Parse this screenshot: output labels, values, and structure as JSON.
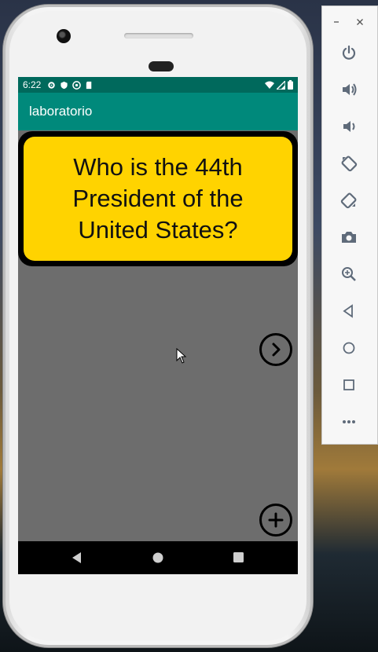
{
  "status_bar": {
    "time": "6:22"
  },
  "app_bar": {
    "title": "laboratorio"
  },
  "question_card": {
    "text": "Who is the 44th President of the United States?"
  },
  "colors": {
    "status_bar": "#00695c",
    "app_bar": "#00897b",
    "card_fill": "#ffd300",
    "card_border": "#000000",
    "content_bg": "#6d6d6d"
  },
  "buttons": {
    "next": {
      "icon": "chevron-right-circle-icon"
    },
    "add": {
      "icon": "plus-circle-icon"
    }
  },
  "navigation_bar": {
    "icons": [
      "back-icon",
      "home-icon",
      "recents-icon"
    ]
  },
  "emulator_window": {
    "icons": [
      "minimize-icon",
      "close-icon"
    ]
  },
  "emulator_toolbar": {
    "icons": [
      "power-icon",
      "volume-up-icon",
      "volume-down-icon",
      "rotate-left-icon",
      "rotate-right-icon",
      "camera-icon",
      "zoom-icon",
      "back-icon",
      "home-icon",
      "overview-icon",
      "more-icon"
    ]
  }
}
